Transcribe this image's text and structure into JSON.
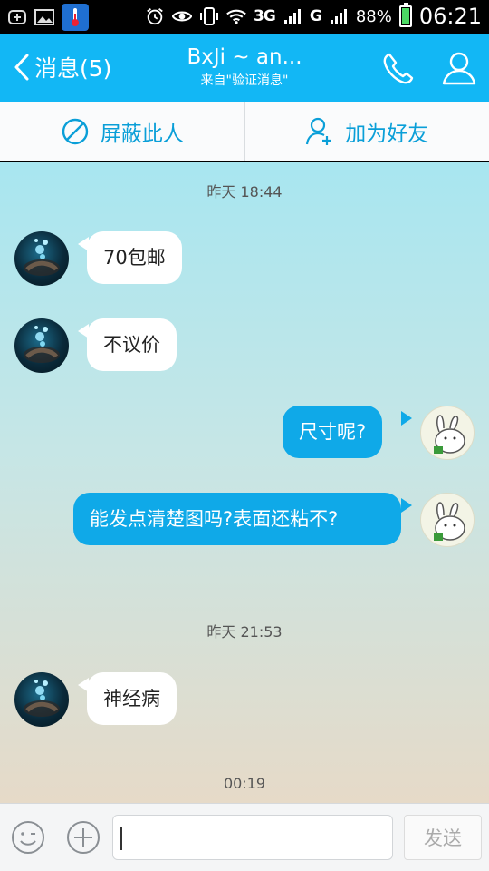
{
  "status_bar": {
    "network1": "3G",
    "network2": "G",
    "battery_percent": "88%",
    "battery_level": 0.88,
    "time": "06:21",
    "icons": [
      "plus-icon",
      "image-icon",
      "thermometer-app-icon",
      "alarm-icon",
      "eye-icon",
      "vibrate-icon",
      "wifi-icon",
      "signal-icon",
      "battery-icon"
    ]
  },
  "header": {
    "back_label": "消息(5)",
    "title": "BxJi ~ an...",
    "subtitle": "来自\"验证消息\"",
    "bg_color": "#12b7f5"
  },
  "actions": {
    "block_label": "屏蔽此人",
    "add_friend_label": "加为好友",
    "accent": "#0a9fd8"
  },
  "messages": [
    {
      "type": "time",
      "text": "昨天 18:44"
    },
    {
      "type": "in",
      "text": "70包邮"
    },
    {
      "type": "in",
      "text": "不议价"
    },
    {
      "type": "out",
      "text": "尺寸呢?"
    },
    {
      "type": "out",
      "text": "能发点清楚图吗?表面还粘不?"
    },
    {
      "type": "time",
      "text": "昨天 21:53"
    },
    {
      "type": "in",
      "text": "神经病"
    },
    {
      "type": "time",
      "text": "00:19"
    }
  ],
  "input": {
    "value": "",
    "send_label": "发送"
  }
}
